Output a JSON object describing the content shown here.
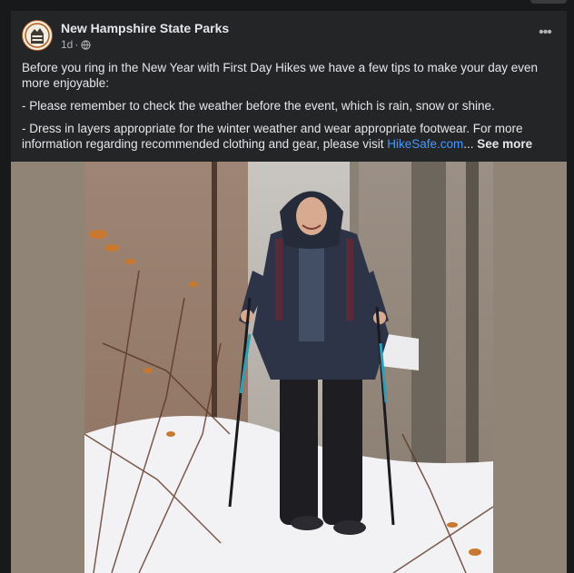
{
  "post": {
    "page_name": "New Hampshire State Parks",
    "avatar_text": "STATE PARKS",
    "time": "1d",
    "dot": "·",
    "privacy_icon": "globe-icon",
    "more_icon": "ellipsis-icon",
    "paragraphs": [
      "Before you ring in the New Year with First Day Hikes we have a few tips to make your day even more enjoyable:",
      "- Please remember to check the weather before the event, which is rain, snow or shine."
    ],
    "last_paragraph_text": "- Dress in layers appropriate for the winter weather and wear appropriate footwear. For more information regarding recommended clothing and gear, please visit ",
    "link_text": "HikeSafe.com",
    "ellipsis": "... ",
    "see_more": "See more"
  },
  "colors": {
    "card_bg": "#242526",
    "page_bg": "#18191a",
    "link": "#4599ff",
    "photo_matte": "#8f8476"
  }
}
